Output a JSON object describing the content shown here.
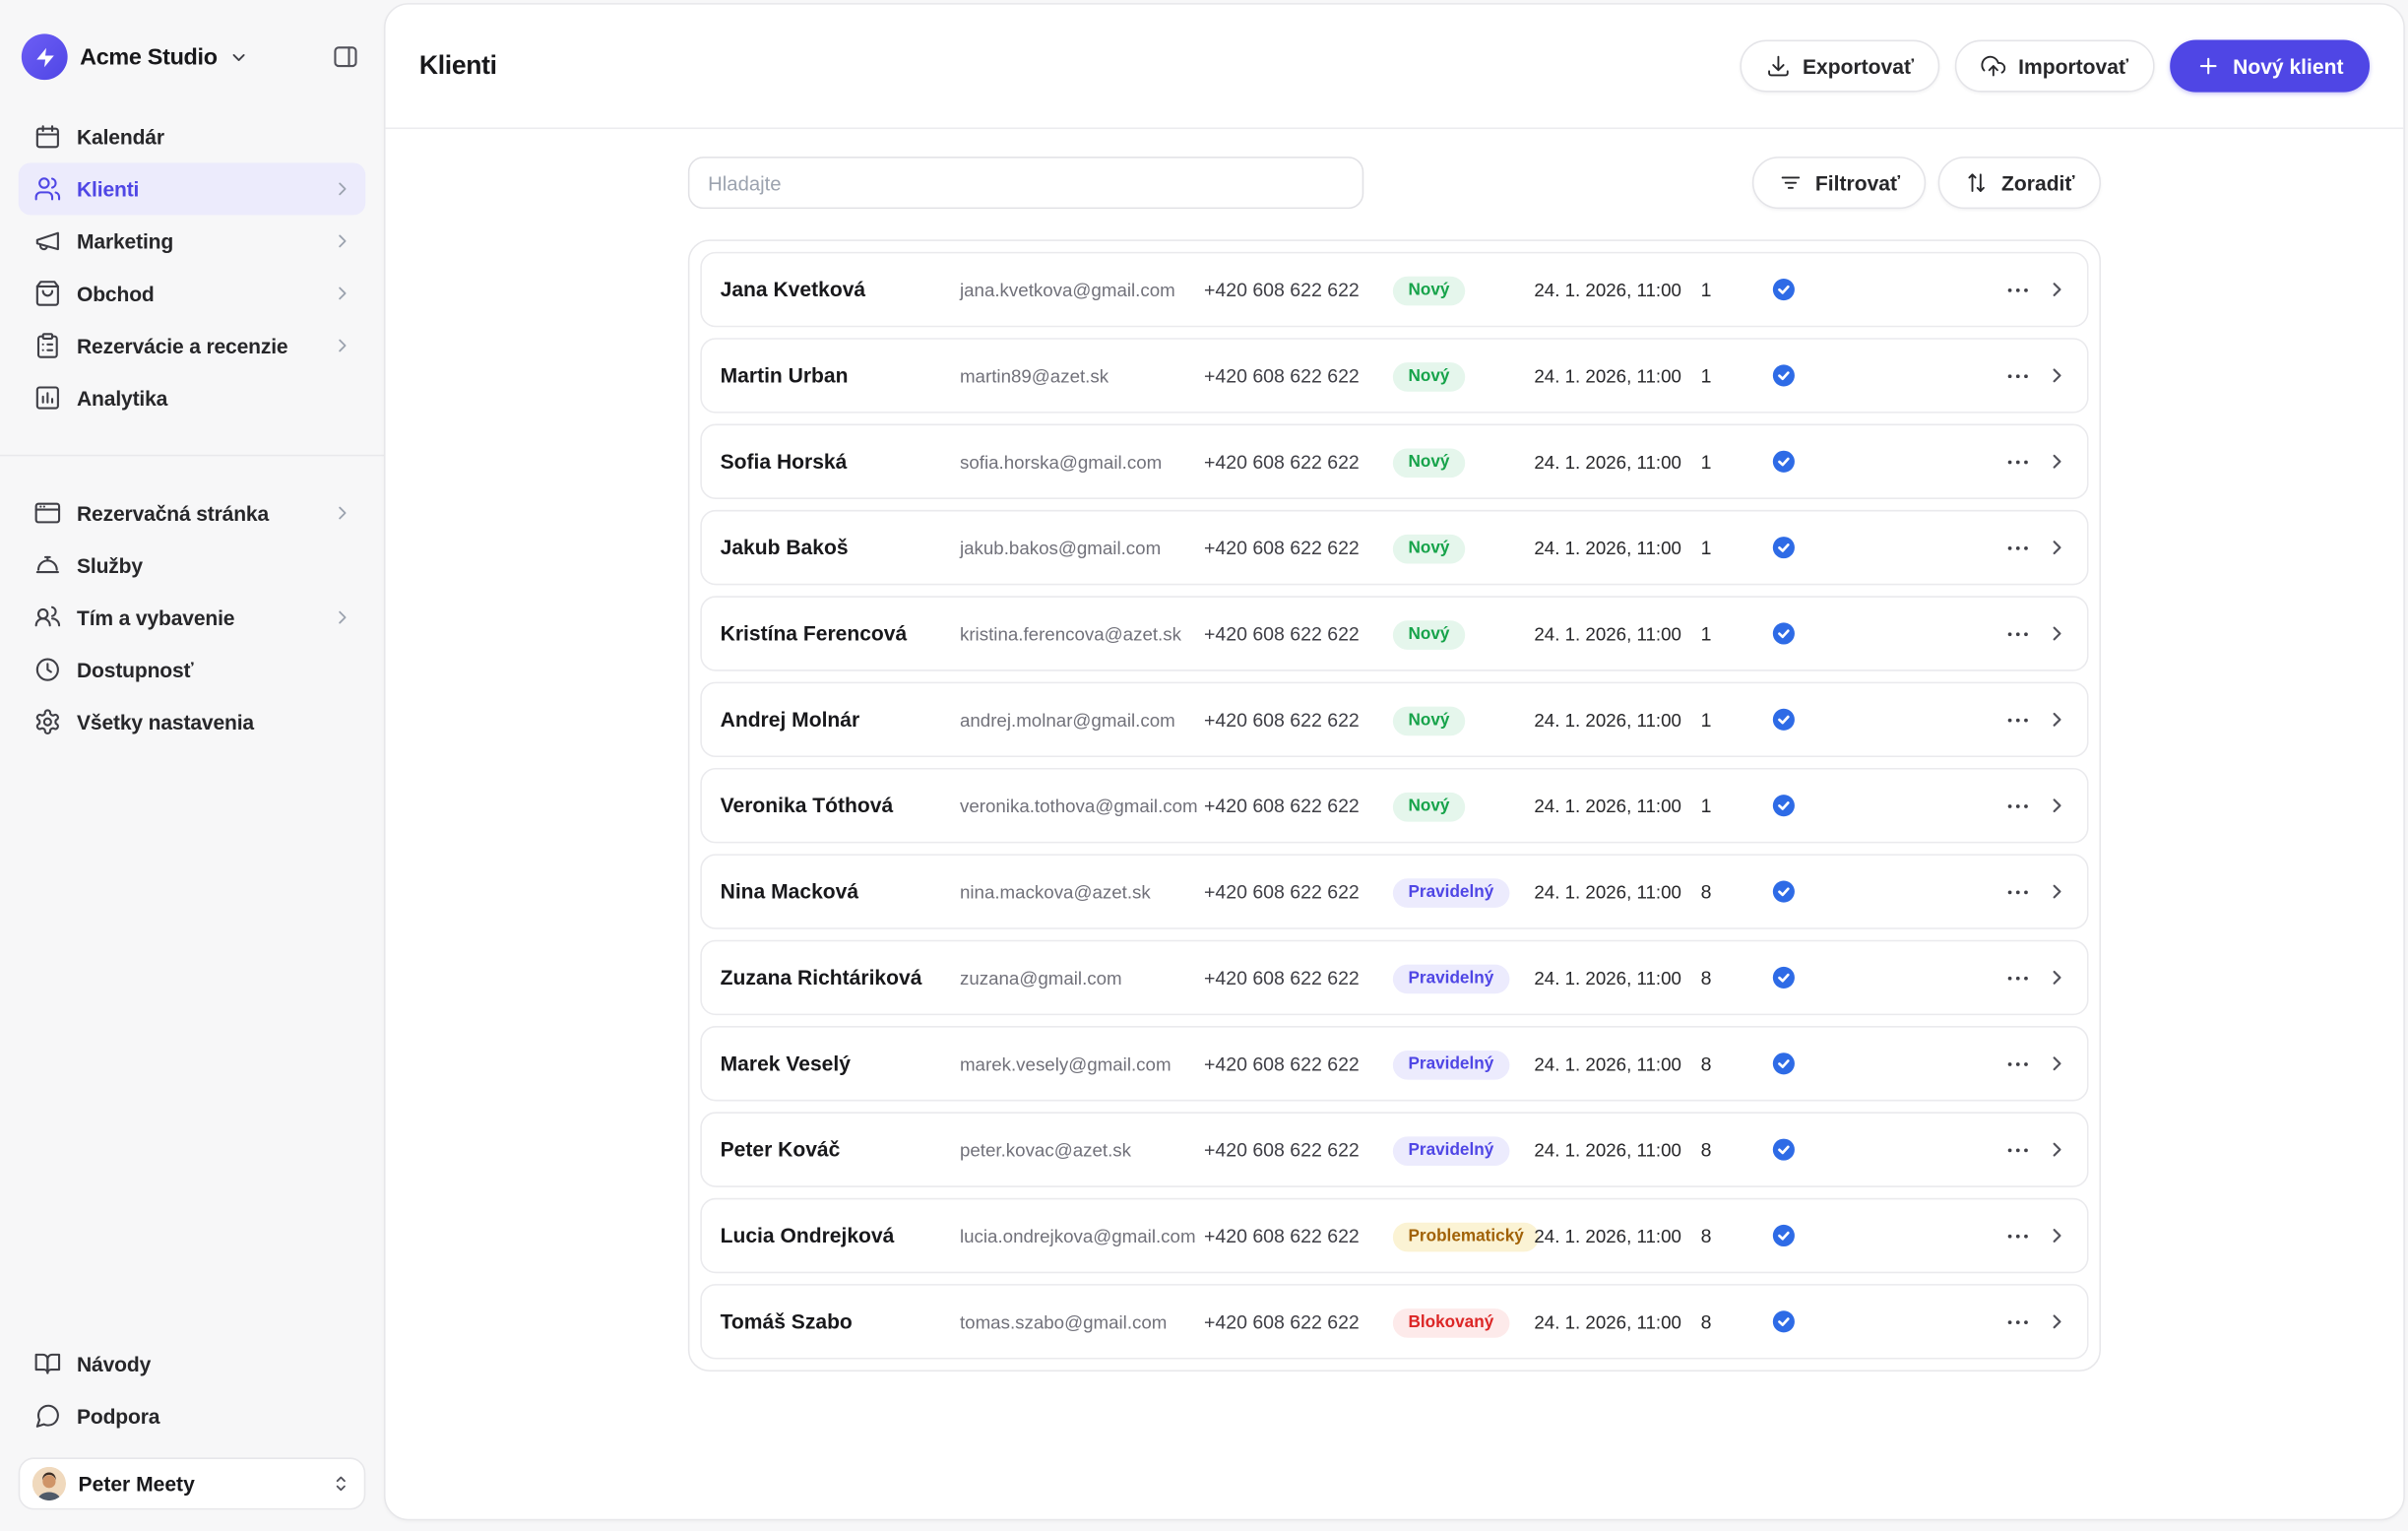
{
  "colors": {
    "accent": "#4f46e5",
    "accent_soft": "#ecebfc",
    "verified_badge": "#2e6be6"
  },
  "status_styles": {
    "new": {
      "bg": "#e5f6ec",
      "text": "#16a34a"
    },
    "regular": {
      "bg": "#ecebfd",
      "text": "#4f46e5"
    },
    "problem": {
      "bg": "#fbf3d4",
      "text": "#a16207"
    },
    "blocked": {
      "bg": "#fdeaea",
      "text": "#dc2626"
    }
  },
  "sidebar": {
    "workspace": {
      "name": "Acme Studio"
    },
    "nav_main": [
      {
        "key": "kalendar",
        "label": "Kalendár",
        "icon": "calendar-icon",
        "chevron": false,
        "active": false
      },
      {
        "key": "klienti",
        "label": "Klienti",
        "icon": "users-icon",
        "chevron": true,
        "active": true
      },
      {
        "key": "marketing",
        "label": "Marketing",
        "icon": "megaphone-icon",
        "chevron": true,
        "active": false
      },
      {
        "key": "obchod",
        "label": "Obchod",
        "icon": "shop-icon",
        "chevron": true,
        "active": false
      },
      {
        "key": "rezervacie-a-recenzie",
        "label": "Rezervácie a recenzie",
        "icon": "reservations-icon",
        "chevron": true,
        "active": false
      },
      {
        "key": "analytika",
        "label": "Analytika",
        "icon": "analytics-icon",
        "chevron": false,
        "active": false
      }
    ],
    "nav_secondary": [
      {
        "key": "rezervacna-stranka",
        "label": "Rezervačná stránka",
        "icon": "booking-page-icon",
        "chevron": true,
        "active": false
      },
      {
        "key": "sluzby",
        "label": "Služby",
        "icon": "services-icon",
        "chevron": false,
        "active": false
      },
      {
        "key": "tim-a-vybavenie",
        "label": "Tím a vybavenie",
        "icon": "team-icon",
        "chevron": true,
        "active": false
      },
      {
        "key": "dostupnost",
        "label": "Dostupnosť",
        "icon": "availability-icon",
        "chevron": false,
        "active": false
      },
      {
        "key": "vsetky-nastavenia",
        "label": "Všetky nastavenia",
        "icon": "settings-icon",
        "chevron": false,
        "active": false
      }
    ],
    "nav_bottom": [
      {
        "key": "navody",
        "label": "Návody",
        "icon": "guides-icon",
        "chevron": false,
        "active": false
      },
      {
        "key": "podpora",
        "label": "Podpora",
        "icon": "support-icon",
        "chevron": false,
        "active": false
      }
    ],
    "user": {
      "name": "Peter Meety"
    }
  },
  "header": {
    "title": "Klienti",
    "export_label": "Exportovať",
    "import_label": "Importovať",
    "new_client_label": "Nový klient"
  },
  "toolbar": {
    "search_placeholder": "Hladajte",
    "filter_label": "Filtrovať",
    "sort_label": "Zoradiť"
  },
  "clients": [
    {
      "name": "Jana Kvetková",
      "email": "jana.kvetkova@gmail.com",
      "phone": "+420 608 622 622",
      "status": "Nový",
      "status_type": "new",
      "date": "24. 1. 2026, 11:00",
      "count": "1"
    },
    {
      "name": "Martin Urban",
      "email": "martin89@azet.sk",
      "phone": "+420 608 622 622",
      "status": "Nový",
      "status_type": "new",
      "date": "24. 1. 2026, 11:00",
      "count": "1"
    },
    {
      "name": "Sofia Horská",
      "email": "sofia.horska@gmail.com",
      "phone": "+420 608 622 622",
      "status": "Nový",
      "status_type": "new",
      "date": "24. 1. 2026, 11:00",
      "count": "1"
    },
    {
      "name": "Jakub Bakoš",
      "email": "jakub.bakos@gmail.com",
      "phone": "+420 608 622 622",
      "status": "Nový",
      "status_type": "new",
      "date": "24. 1. 2026, 11:00",
      "count": "1"
    },
    {
      "name": "Kristína Ferencová",
      "email": "kristina.ferencova@azet.sk",
      "phone": "+420 608 622 622",
      "status": "Nový",
      "status_type": "new",
      "date": "24. 1. 2026, 11:00",
      "count": "1"
    },
    {
      "name": "Andrej Molnár",
      "email": "andrej.molnar@gmail.com",
      "phone": "+420 608 622 622",
      "status": "Nový",
      "status_type": "new",
      "date": "24. 1. 2026, 11:00",
      "count": "1"
    },
    {
      "name": "Veronika Tóthová",
      "email": "veronika.tothova@gmail.com",
      "phone": "+420 608 622 622",
      "status": "Nový",
      "status_type": "new",
      "date": "24. 1. 2026, 11:00",
      "count": "1"
    },
    {
      "name": "Nina Macková",
      "email": "nina.mackova@azet.sk",
      "phone": "+420 608 622 622",
      "status": "Pravidelný",
      "status_type": "regular",
      "date": "24. 1. 2026, 11:00",
      "count": "8"
    },
    {
      "name": "Zuzana Richtáriková",
      "email": "zuzana@gmail.com",
      "phone": "+420 608 622 622",
      "status": "Pravidelný",
      "status_type": "regular",
      "date": "24. 1. 2026, 11:00",
      "count": "8"
    },
    {
      "name": "Marek Veselý",
      "email": "marek.vesely@gmail.com",
      "phone": "+420 608 622 622",
      "status": "Pravidelný",
      "status_type": "regular",
      "date": "24. 1. 2026, 11:00",
      "count": "8"
    },
    {
      "name": "Peter Kováč",
      "email": "peter.kovac@azet.sk",
      "phone": "+420 608 622 622",
      "status": "Pravidelný",
      "status_type": "regular",
      "date": "24. 1. 2026, 11:00",
      "count": "8"
    },
    {
      "name": "Lucia Ondrejková",
      "email": "lucia.ondrejkova@gmail.com",
      "phone": "+420 608 622 622",
      "status": "Problematický",
      "status_type": "problem",
      "date": "24. 1. 2026, 11:00",
      "count": "8"
    },
    {
      "name": "Tomáš Szabo",
      "email": "tomas.szabo@gmail.com",
      "phone": "+420 608 622 622",
      "status": "Blokovaný",
      "status_type": "blocked",
      "date": "24. 1. 2026, 11:00",
      "count": "8"
    }
  ]
}
